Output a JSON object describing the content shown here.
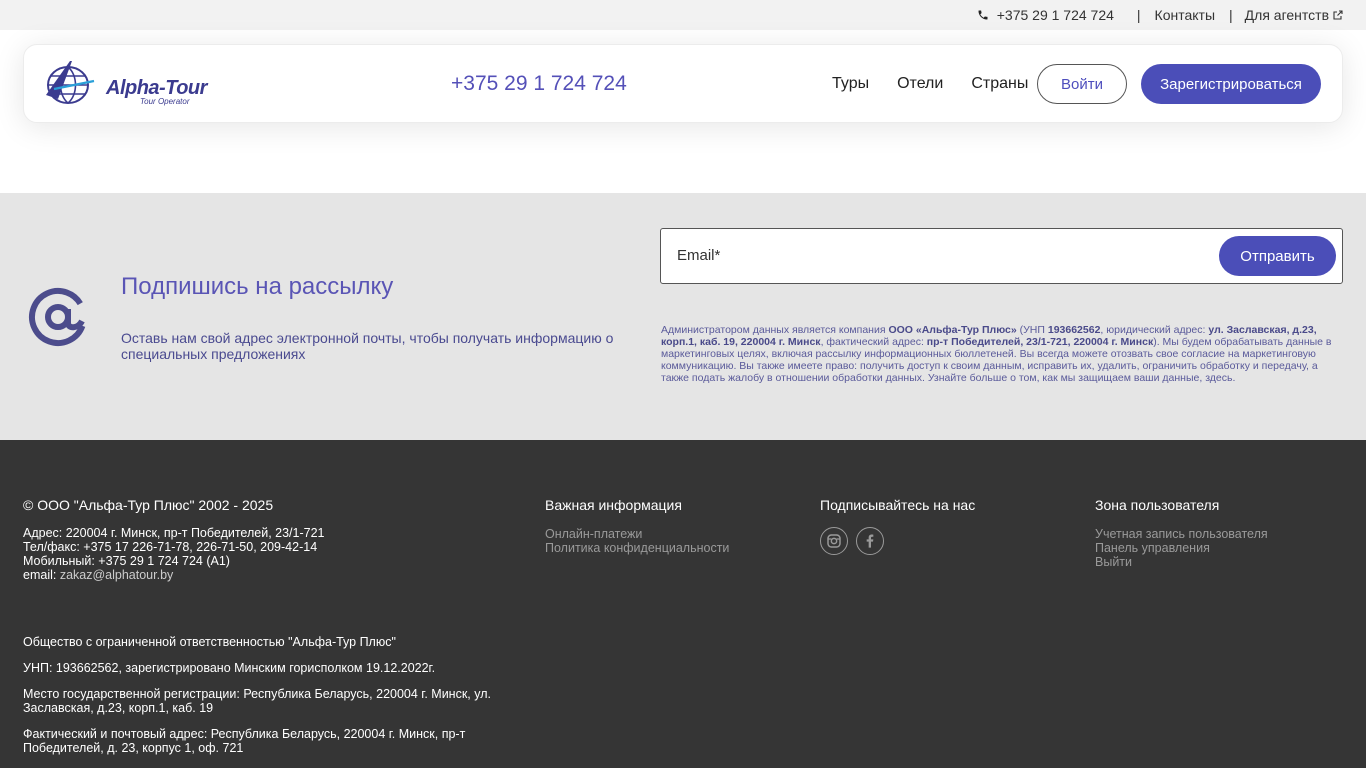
{
  "topbar": {
    "phone": "+375 29 1 724 724",
    "separator": "|",
    "contacts": "Контакты",
    "agents": "Для агентств"
  },
  "header": {
    "logo_text": "Alpha-Tour",
    "logo_sub": "Tour Operator",
    "phone": "+375 29 1 724 724",
    "nav": [
      "Туры",
      "Отели",
      "Страны"
    ],
    "login": "Войти",
    "register": "Зарегистрироваться"
  },
  "newsletter": {
    "title": "Подпишись на рассылку",
    "description": "Оставь нам свой адрес электронной почты, чтобы получать информацию о специальных предложениях",
    "email_placeholder": "Email*",
    "send": "Отправить",
    "legal": {
      "p1": "Администратором данных является компания ",
      "company": "ООО «Альфа-Тур Плюс»",
      "p2": " (УНП ",
      "unp": "193662562",
      "p3": ", юридический адрес: ",
      "legal_addr": "ул. Заславская, д.23, корп.1, каб. 19, 220004 г. Минск",
      "p4": ", фактический адрес: ",
      "actual_addr": "пр-т Победителей, 23/1-721, 220004 г. Минск",
      "p5": "). Мы будем обрабатывать данные в маркетинговых целях, включая рассылку информационных бюллетеней. Вы всегда можете отозвать свое согласие на маркетинговую коммуникацию. Вы также имеете право: получить доступ к своим данным, исправить их, удалить, ограничить обработку и передачу, а также подать жалобу в отношении обработки данных. Узнайте больше о том, как мы защищаем ваши данные, ",
      "link": "здесь",
      "p6": "."
    }
  },
  "footer": {
    "copyright": "© ООО \"Альфа-Тур Плюс\" 2002 - 2025",
    "address": "Адрес: 220004 г. Минск, пр-т Победителей, 23/1-721",
    "telfax": "Тел/факс: +375 17 226-71-78, 226-71-50, 209-42-14",
    "mobile": "Мобильный: +375 29 1 724 724 (A1)",
    "email_label": "email: ",
    "email": "zakaz@alphatour.by",
    "org": "Общество с ограниченной ответственностью \"Альфа-Тур Плюс\"",
    "unp": "УНП: 193662562, зарегистрировано Минским горисполком 19.12.2022г.",
    "reg_place": "Место государственной регистрации: Республика Беларусь, 220004 г. Минск, ул. Заславская, д.23, корп.1, каб. 19",
    "postal": "Фактический и почтовый адрес: Республика Беларусь, 220004 г. Минск, пр-т Победителей, д. 23, корпус 1, оф. 721",
    "important": {
      "title": "Важная информация",
      "links": [
        "Онлайн-платежи",
        "Политика конфиденциальности"
      ]
    },
    "social": {
      "title": "Подписывайтесь на нас",
      "icons": [
        "instagram-icon",
        "facebook-icon"
      ]
    },
    "user_zone": {
      "title": "Зона пользователя",
      "links": [
        "Учетная запись пользователя",
        "Панель управления",
        "Выйти"
      ]
    }
  },
  "colors": {
    "accent": "#4b4eb8",
    "footer_bg": "#353535",
    "newsletter_bg": "#e5e5e5"
  }
}
